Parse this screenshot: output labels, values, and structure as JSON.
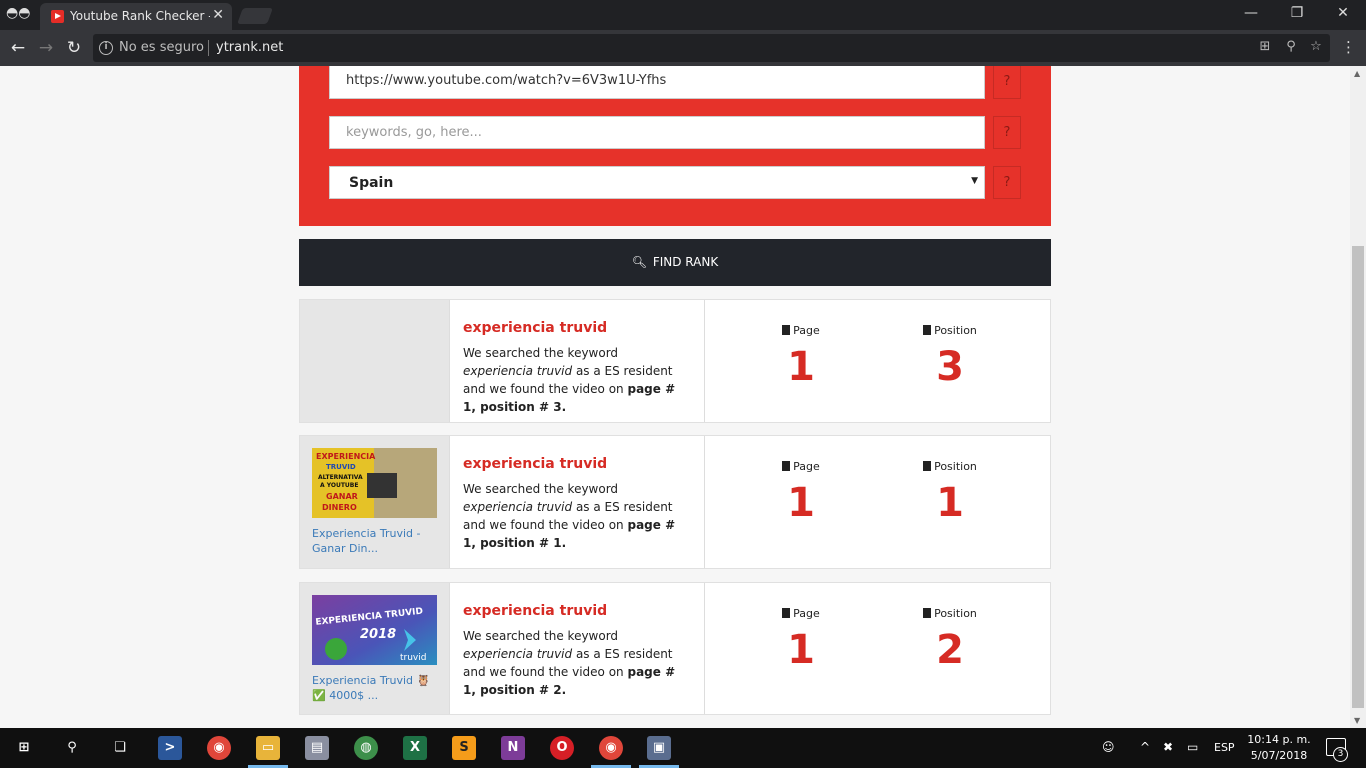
{
  "browser": {
    "tab_title": "Youtube Rank Checker - F",
    "security_label": "No es seguro",
    "url": "ytrank.net"
  },
  "form": {
    "video_url_value": "https://www.youtube.com/watch?v=6V3w1U-Yfhs",
    "keywords_placeholder": "keywords, go, here...",
    "country_selected": "Spain",
    "help_label": "?",
    "find_button_label": "FIND RANK"
  },
  "labels": {
    "page": "Page",
    "position": "Position"
  },
  "results": [
    {
      "keyword": "experiencia truvid",
      "desc_prefix": "We searched the keyword ",
      "desc_keyword": "experiencia truvid",
      "desc_middle": " as a ES resident and we found the video on ",
      "desc_result": "page # 1, position # 3.",
      "thumb_link": "",
      "page": "1",
      "position": "3"
    },
    {
      "keyword": "experiencia truvid",
      "desc_prefix": "We searched the keyword ",
      "desc_keyword": "experiencia truvid",
      "desc_middle": " as a ES resident and we found the video on ",
      "desc_result": "page # 1, position # 1.",
      "thumb_link": "Experiencia Truvid - Ganar Din...",
      "thumb_text": [
        "EXPERIENCIA",
        "TRUVID",
        "ALTERNATIVA",
        "A YOUTUBE",
        "GANAR",
        "DINERO"
      ],
      "page": "1",
      "position": "1"
    },
    {
      "keyword": "experiencia truvid",
      "desc_prefix": "We searched the keyword ",
      "desc_keyword": "experiencia truvid",
      "desc_middle": " as a ES resident and we found the video on ",
      "desc_result": "page # 1, position # 2.",
      "thumb_link": "Experiencia Truvid 🦉 ✅ 4000$ ...",
      "thumb_text": [
        "EXPERIENCIA TRUVID",
        "2018",
        "truvid"
      ],
      "page": "1",
      "position": "2"
    }
  ],
  "taskbar": {
    "language": "ESP",
    "time": "10:14 p. m.",
    "date": "5/07/2018",
    "notifications": "3"
  },
  "colors": {
    "accent_red": "#e6322a",
    "dark_button": "#22252b",
    "link_blue": "#3b7ab8"
  }
}
